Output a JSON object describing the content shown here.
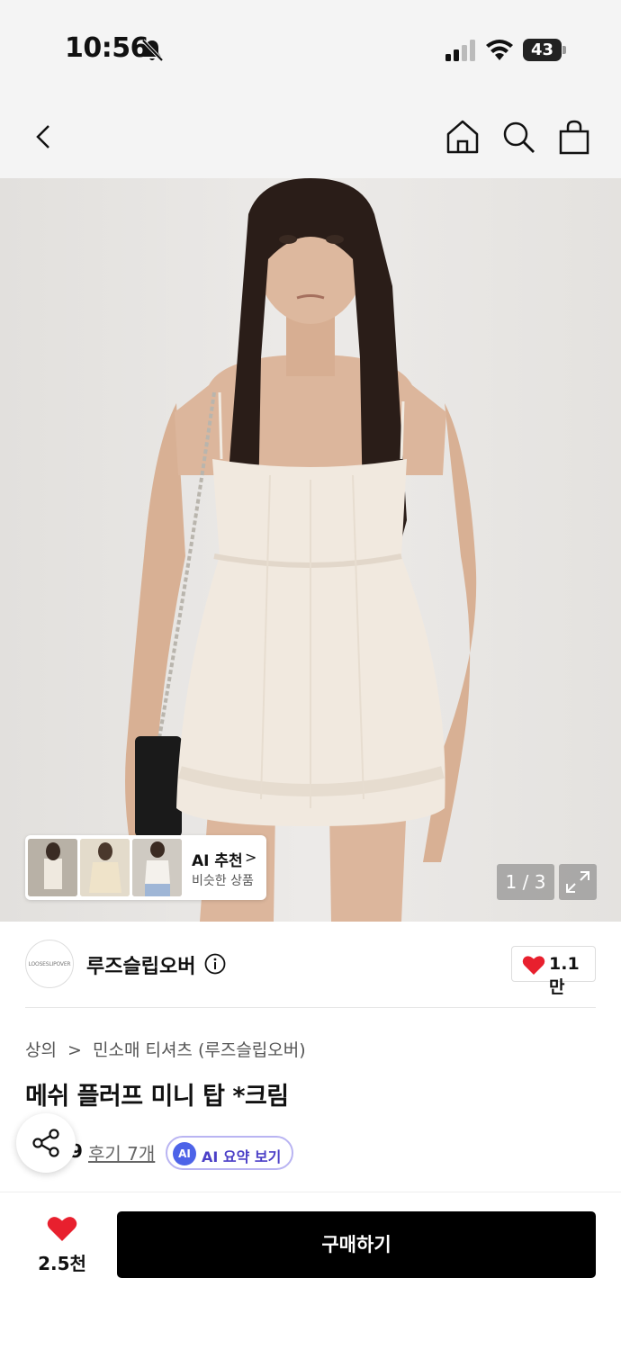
{
  "status_bar": {
    "time": "10:56",
    "battery": "43",
    "icons": [
      "bell-off-icon",
      "signal-icon",
      "wifi-icon",
      "battery-icon"
    ]
  },
  "nav": {
    "icons": [
      "back-icon",
      "home-icon",
      "search-icon",
      "bag-icon"
    ]
  },
  "gallery": {
    "counter": "1 / 3",
    "ai_card": {
      "title": "AI 추천",
      "subtitle": "비슷한 상품",
      "chevron": ">"
    }
  },
  "brand": {
    "logo_text": "LOOSESLIPOVER",
    "name": "루즈슬립오버",
    "likes": "1.1만"
  },
  "product": {
    "breadcrumb": [
      "상의",
      ">",
      "민소매 티셔츠 (루즈슬립오버)"
    ],
    "title": "메쉬 플러프 미니 탑 *크림",
    "rating_tail": "9",
    "reviews": "후기 7개",
    "ai_summary": {
      "badge": "AI",
      "label": "AI 요약 보기"
    }
  },
  "bottom": {
    "wishlist_count": "2.5천",
    "buy_label": "구매하기"
  },
  "colors": {
    "heart": "#e8202e",
    "buy_button": "#000000",
    "ai_badge": "#4d63e8",
    "ai_text": "#4b3fc7"
  }
}
